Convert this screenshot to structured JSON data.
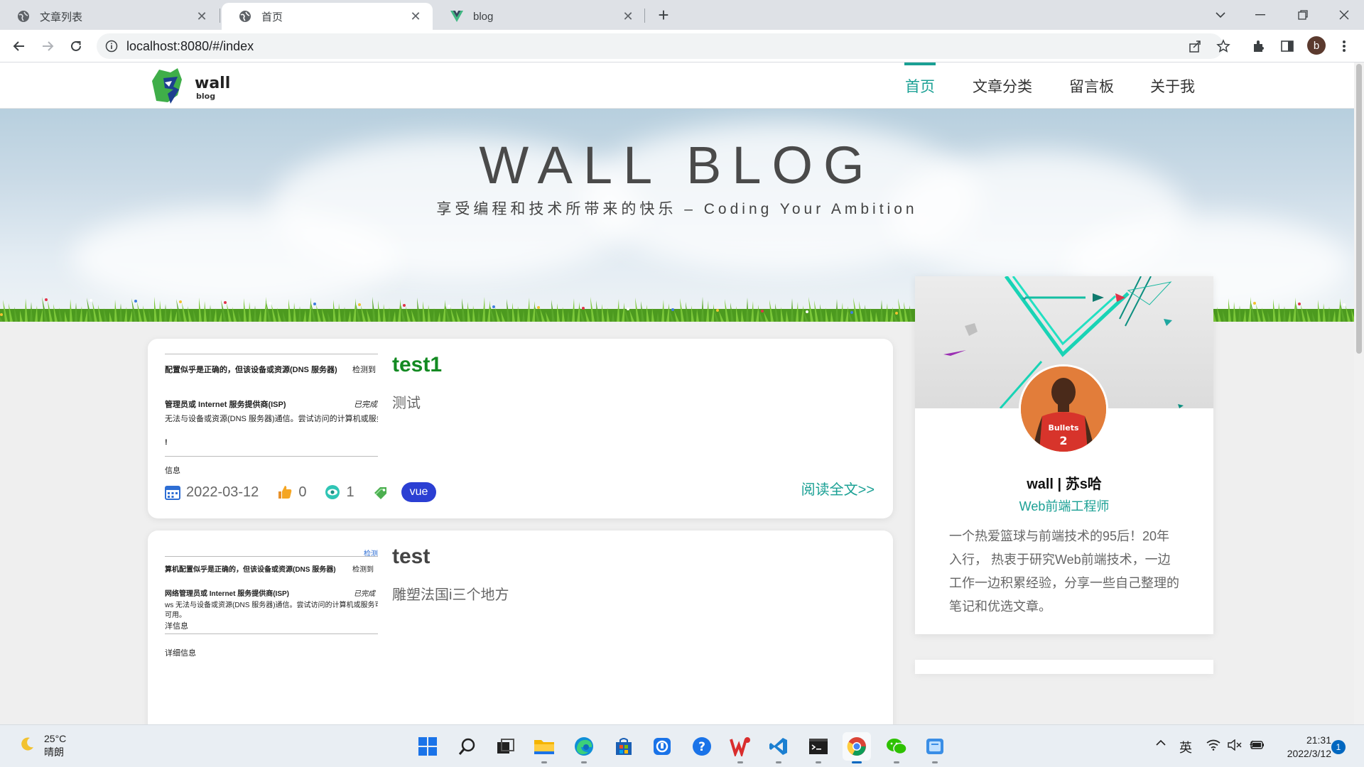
{
  "browser": {
    "tabs": [
      {
        "title": "文章列表",
        "icon": "globe-icon"
      },
      {
        "title": "首页",
        "icon": "globe-icon"
      },
      {
        "title": "blog",
        "icon": "vue-icon"
      }
    ],
    "url": "localhost:8080/#/index",
    "profile_initial": "b"
  },
  "site": {
    "logo_text": "wall",
    "logo_sub": "blog",
    "nav": [
      "首页",
      "文章分类",
      "留言板",
      "关于我"
    ],
    "active_nav": "首页",
    "accent_color": "#1aa094"
  },
  "banner": {
    "title": "WALL BLOG",
    "subtitle": "享受编程和技术所带来的快乐 – Coding Your Ambition"
  },
  "articles": [
    {
      "title": "test1",
      "title_color": "#138a22",
      "desc": "测试",
      "date": "2022-03-12",
      "likes": "0",
      "views": "1",
      "tag": "vue",
      "read_more": "阅读全文>>",
      "thumb_lines": [
        "配置似乎是正确的，但该设备或资源(DNS 服务器)",
        "检测到",
        "管理员或 Internet 服务提供商(ISP)",
        "已完成",
        "无法与设备或资源(DNS 服务器)通信。尝试访问的计算机或服务",
        "!",
        "信息"
      ]
    },
    {
      "title": "test",
      "title_color": "#444444",
      "desc": "雕塑法国i三个地方",
      "thumb_lines": [
        "检测",
        "算机配置似乎是正确的，但该设备或资源(DNS 服务器)",
        "检测到",
        "网络管理员或 Internet 服务提供商(ISP)",
        "已完成",
        "ws 无法与设备或资源(DNS 服务器)通信。尝试访问的计算机或服务可能",
        "可用。",
        "洋信息",
        "详细信息"
      ]
    }
  ],
  "profile": {
    "name": "wall | 苏s哈",
    "title": "Web前端工程师",
    "description": "一个热爱篮球与前端技术的95后！20年入行， 热衷于研究Web前端技术，一边工作一边积累经验，分享一些自己整理的笔记和优选文章。",
    "jersey_text": "Bullets",
    "jersey_number": "2"
  },
  "taskbar": {
    "weather_temp": "25°C",
    "weather_desc": "晴朗",
    "ime": "英",
    "time": "21:31",
    "date": "2022/3/12",
    "notifications": "1"
  }
}
